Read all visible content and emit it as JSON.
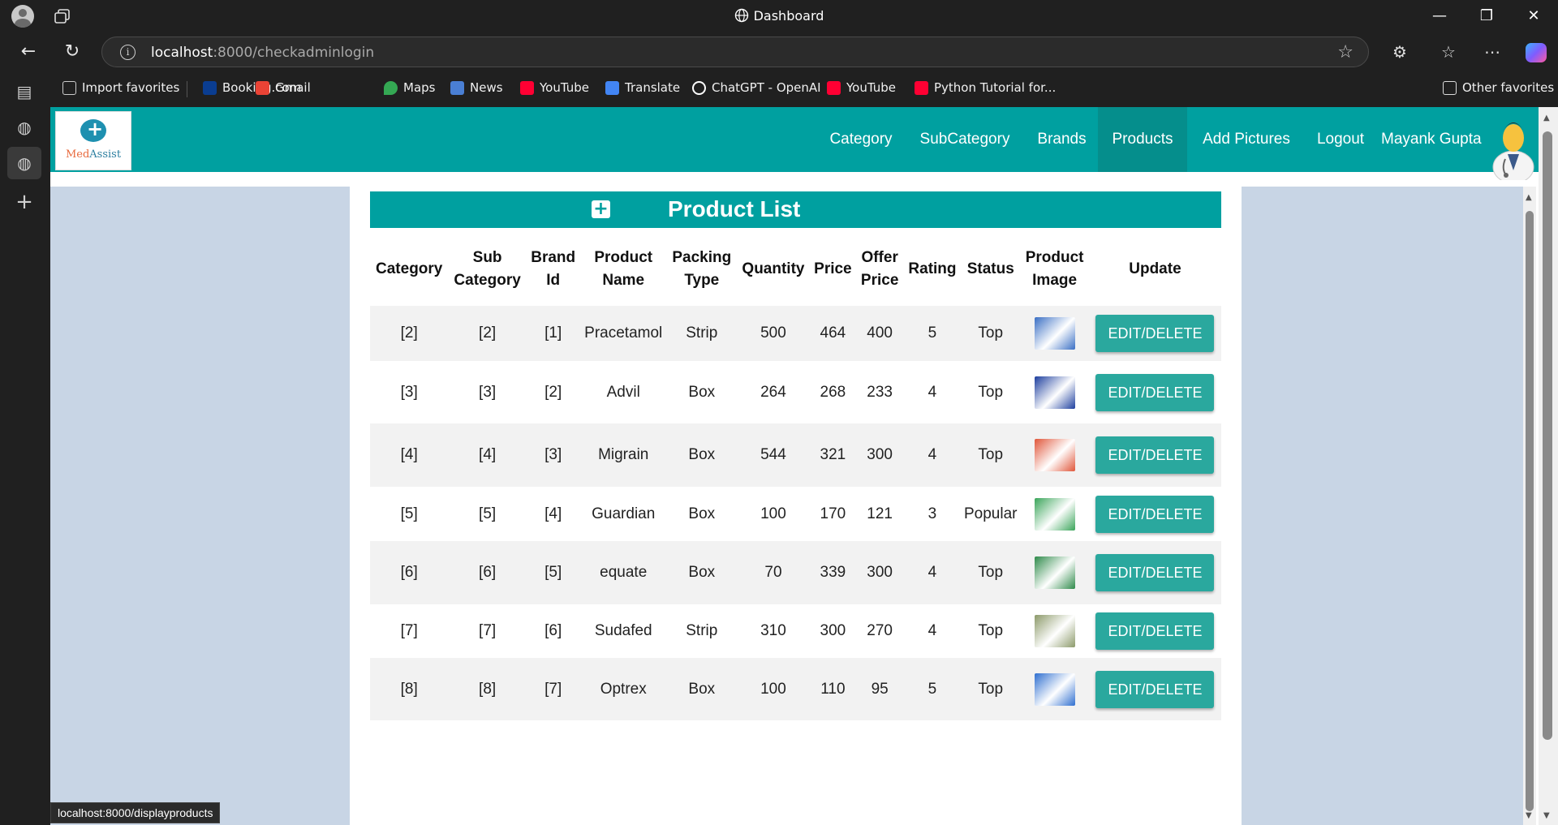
{
  "window": {
    "title": "Dashboard",
    "controls": [
      "—",
      "❐",
      "✕"
    ]
  },
  "addressbar": {
    "url_host": "localhost",
    "url_rest": ":8000/checkadminlogin"
  },
  "favorites": [
    {
      "label": "Import favorites",
      "icon": "import-icon",
      "color": "#cccccc"
    },
    {
      "label": "Booking.com",
      "icon": "booking-icon",
      "color": "#0a3d91"
    },
    {
      "label": "Gmail",
      "icon": "gmail-icon",
      "color": "#ea4335"
    },
    {
      "label": "Maps",
      "icon": "maps-icon",
      "color": "#34a853"
    },
    {
      "label": "News",
      "icon": "news-icon",
      "color": "#4a7fd4"
    },
    {
      "label": "YouTube",
      "icon": "youtube-icon",
      "color": "#ff0033"
    },
    {
      "label": "Translate",
      "icon": "translate-icon",
      "color": "#4285f4"
    },
    {
      "label": "ChatGPT - OpenAI",
      "icon": "chatgpt-icon",
      "color": "#ffffff"
    },
    {
      "label": "YouTube",
      "icon": "youtube-icon",
      "color": "#ff0033"
    },
    {
      "label": "Python Tutorial for...",
      "icon": "youtube-icon",
      "color": "#ff0033"
    }
  ],
  "other_favorites": "Other favorites",
  "app": {
    "logo_part1": "Med",
    "logo_part2": "Assist",
    "nav": [
      "Category",
      "SubCategory",
      "Brands",
      "Products",
      "Add Pictures",
      "Logout"
    ],
    "active_nav": "Products",
    "user": "Mayank Gupta",
    "accent": "#00a0a0"
  },
  "list": {
    "title": "Product List",
    "headers": [
      [
        "Category"
      ],
      [
        "Sub",
        "Category"
      ],
      [
        "Brand",
        "Id"
      ],
      [
        "Product",
        "Name"
      ],
      [
        "Packing",
        "Type"
      ],
      [
        "Quantity"
      ],
      [
        "Price"
      ],
      [
        "Offer",
        "Price"
      ],
      [
        "Rating"
      ],
      [
        "Status"
      ],
      [
        "Product",
        "Image"
      ],
      [
        "Update"
      ]
    ],
    "button_label": "EDIT/DELETE",
    "rows": [
      {
        "category": "[2]",
        "subcategory": "[2]",
        "brand": "[1]",
        "name": "Pracetamol",
        "packing": "Strip",
        "quantity": "500",
        "price": "464",
        "offer": "400",
        "rating": "5",
        "status": "Top",
        "image_color": "#3a6fc4"
      },
      {
        "category": "[3]",
        "subcategory": "[3]",
        "brand": "[2]",
        "name": "Advil",
        "packing": "Box",
        "quantity": "264",
        "price": "268",
        "offer": "233",
        "rating": "4",
        "status": "Top",
        "image_color": "#1d3f9e"
      },
      {
        "category": "[4]",
        "subcategory": "[4]",
        "brand": "[3]",
        "name": "Migrain",
        "packing": "Box",
        "quantity": "544",
        "price": "321",
        "offer": "300",
        "rating": "4",
        "status": "Top",
        "image_color": "#e0563a"
      },
      {
        "category": "[5]",
        "subcategory": "[5]",
        "brand": "[4]",
        "name": "Guardian",
        "packing": "Box",
        "quantity": "100",
        "price": "170",
        "offer": "121",
        "rating": "3",
        "status": "Popular",
        "image_color": "#3aa55a"
      },
      {
        "category": "[6]",
        "subcategory": "[6]",
        "brand": "[5]",
        "name": "equate",
        "packing": "Box",
        "quantity": "70",
        "price": "339",
        "offer": "300",
        "rating": "4",
        "status": "Top",
        "image_color": "#2e8a4a"
      },
      {
        "category": "[7]",
        "subcategory": "[7]",
        "brand": "[6]",
        "name": "Sudafed",
        "packing": "Strip",
        "quantity": "310",
        "price": "300",
        "offer": "270",
        "rating": "4",
        "status": "Top",
        "image_color": "#8c9a6a"
      },
      {
        "category": "[8]",
        "subcategory": "[8]",
        "brand": "[7]",
        "name": "Optrex",
        "packing": "Box",
        "quantity": "100",
        "price": "110",
        "offer": "95",
        "rating": "5",
        "status": "Top",
        "image_color": "#2f6fd0"
      }
    ]
  },
  "statusbar": "localhost:8000/displayproducts"
}
